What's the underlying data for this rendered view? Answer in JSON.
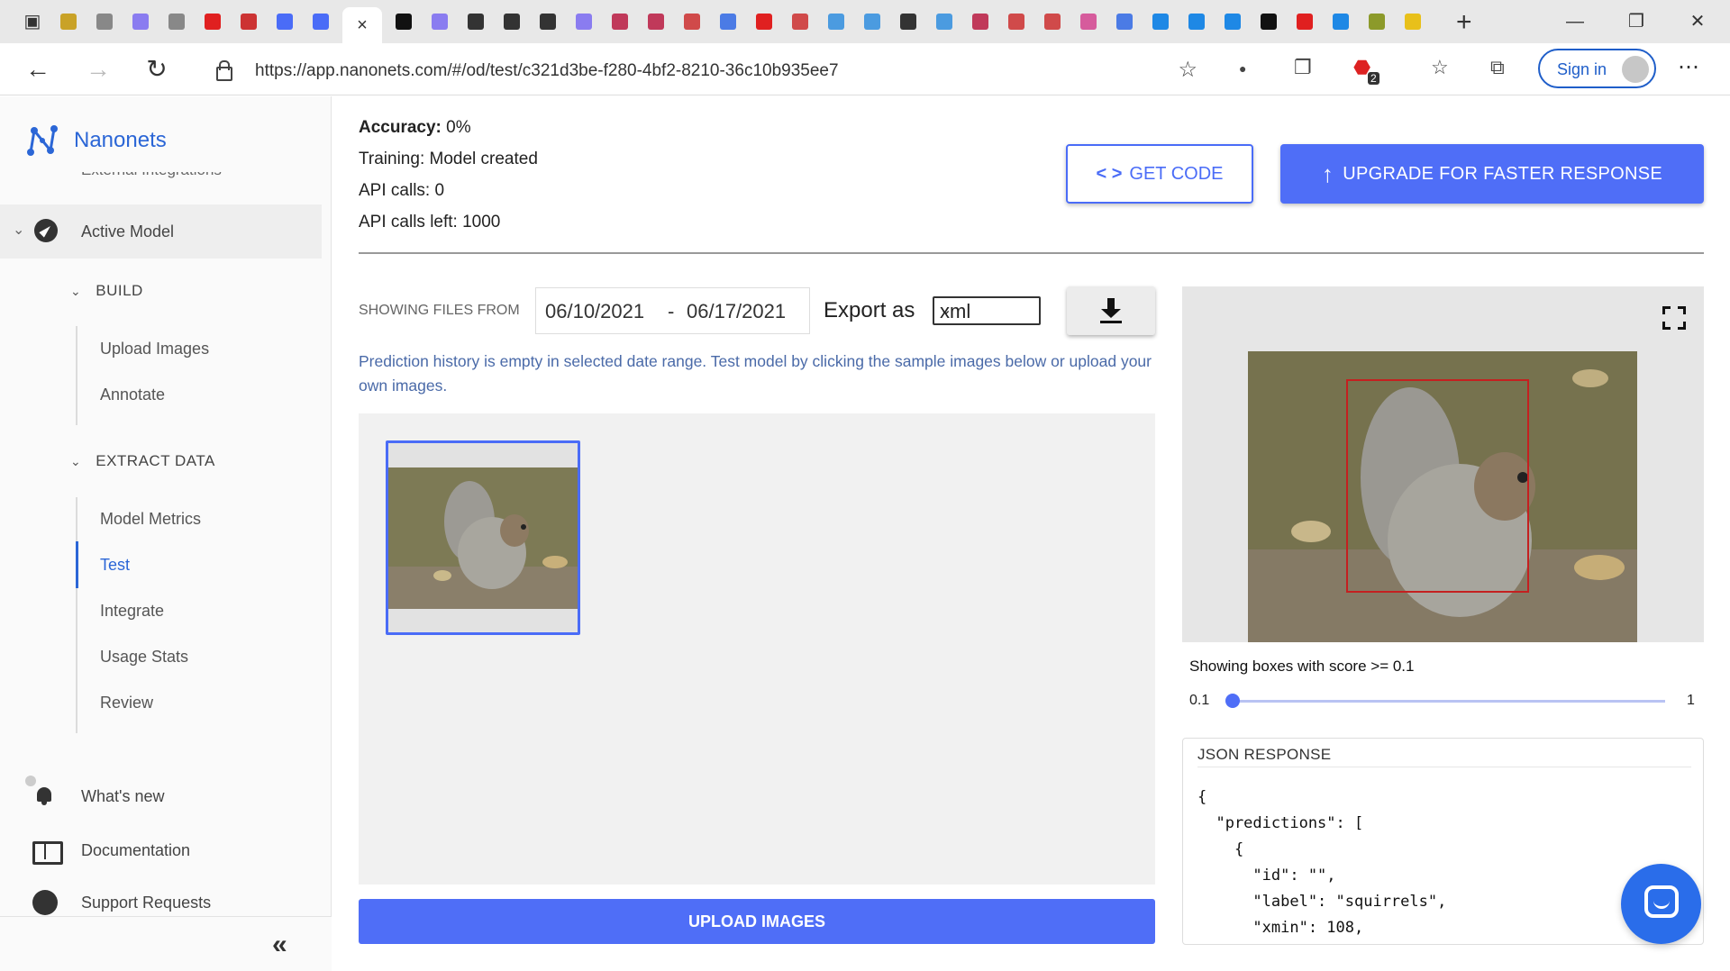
{
  "browser": {
    "tab_close": "×",
    "new_tab": "+",
    "url": "https://app.nanonets.com/#/od/test/c321d3be-f280-4bf2-8210-36c10b935ee7",
    "sign_in": "Sign in",
    "badge_count": "2",
    "tab_favicons": [
      "#c9a227",
      "#888",
      "#8a7cf0",
      "#888",
      "#e02020",
      "#c33",
      "#4a6cf7",
      "#4a6cf7",
      "#111",
      "#8a7cf0",
      "#333",
      "#333",
      "#333",
      "#8a7cf0",
      "#c0395a",
      "#c0395a",
      "#d04a4a",
      "#4b7be5",
      "#e02020",
      "#d04a4a",
      "#4b9be0",
      "#4b9be0",
      "#333",
      "#4b9be0",
      "#c0395a",
      "#d04a4a",
      "#d04a4a",
      "#d65b9c",
      "#4b7be5",
      "#1e88e5",
      "#1e88e5",
      "#1e88e5",
      "#111",
      "#e02020",
      "#1e88e5",
      "#8c9a2a",
      "#e8c01a"
    ]
  },
  "sidebar": {
    "brand": "Nanonets",
    "clipped_item": "External Integrations",
    "active_model": "Active Model",
    "build": {
      "title": "BUILD",
      "items": [
        "Upload Images",
        "Annotate"
      ]
    },
    "extract": {
      "title": "EXTRACT DATA",
      "items": [
        "Model Metrics",
        "Test",
        "Integrate",
        "Usage Stats",
        "Review"
      ]
    },
    "bottom": [
      "What's new",
      "Documentation",
      "Support Requests"
    ],
    "collapse": "«"
  },
  "stats": {
    "accuracy_label": "Accuracy:",
    "accuracy_value": "0%",
    "training": "Training: Model created",
    "api_calls": "API calls: 0",
    "api_calls_left": "API calls left: 1000"
  },
  "actions": {
    "get_code": "GET CODE",
    "upgrade": "UPGRADE FOR FASTER RESPONSE"
  },
  "filter": {
    "showing_label": "SHOWING FILES FROM",
    "date_from": "06/10/2021",
    "date_sep": "-",
    "date_to": "06/17/2021",
    "export_label": "Export as",
    "export_value": "xml"
  },
  "empty_message": "Prediction history is empty in selected date range. Test model by clicking the sample images below or upload your own images.",
  "upload_button": "UPLOAD IMAGES",
  "preview": {
    "score_label": "Showing boxes with score >= 0.1",
    "slider_min": "0.1",
    "slider_max": "1",
    "score_threshold": 0.1
  },
  "json_response": {
    "title": "JSON RESPONSE",
    "body": "{\n  \"predictions\": [\n    {\n      \"id\": \"\",\n      \"label\": \"squirrels\",\n      \"xmin\": 108,"
  }
}
